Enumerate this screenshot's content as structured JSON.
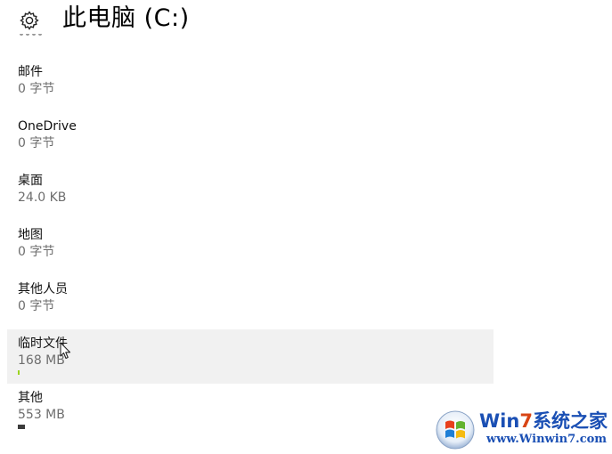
{
  "header": {
    "title": "此电脑 (C:)",
    "settings_icon": "gear-icon"
  },
  "storage_items": [
    {
      "name": "邮件",
      "size": "0 字节",
      "usage": 0
    },
    {
      "name": "OneDrive",
      "size": "0 字节",
      "usage": 0
    },
    {
      "name": "桌面",
      "size": "24.0 KB",
      "usage": 0
    },
    {
      "name": "地图",
      "size": "0 字节",
      "usage": 0
    },
    {
      "name": "其他人员",
      "size": "0 字节",
      "usage": 0
    },
    {
      "name": "临时文件",
      "size": "168 MB",
      "usage": 0.01,
      "hover": true,
      "bar_color": "#9bd41f"
    },
    {
      "name": "其他",
      "size": "553 MB",
      "usage": 0.05,
      "bar_color": "#3c3c3c"
    }
  ],
  "watermark": {
    "brand_prefix": "Wi",
    "brand_n": "n",
    "brand_num": "7",
    "brand_suffix": "系统之家",
    "url": "www.Winwin7.com"
  },
  "colors": {
    "background": "#ffffff",
    "hover_row": "#f1f1f1",
    "secondary_text": "#6e6e6e",
    "temp_files_bar": "#9bd41f",
    "other_bar": "#3c3c3c"
  }
}
